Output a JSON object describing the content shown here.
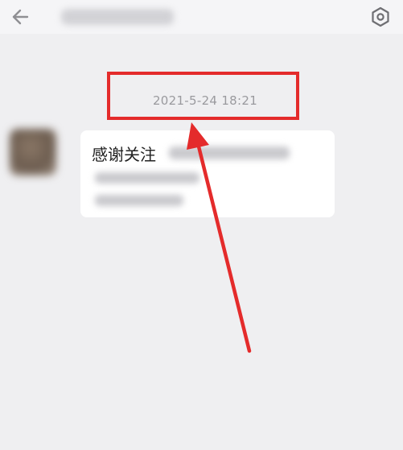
{
  "header": {
    "back_icon": "arrow-left-icon",
    "settings_icon": "hexagon-gear-icon"
  },
  "conversation": {
    "timestamp": "2021-5-24 18:21",
    "message": {
      "title": "感谢关注"
    }
  },
  "annotation": {
    "color": "#e42b2b"
  },
  "colors": {
    "background": "#efeff1",
    "header_background": "#f5f5f7",
    "timestamp_text": "#9a9a9e",
    "bubble_background": "#ffffff",
    "text": "#222222"
  }
}
